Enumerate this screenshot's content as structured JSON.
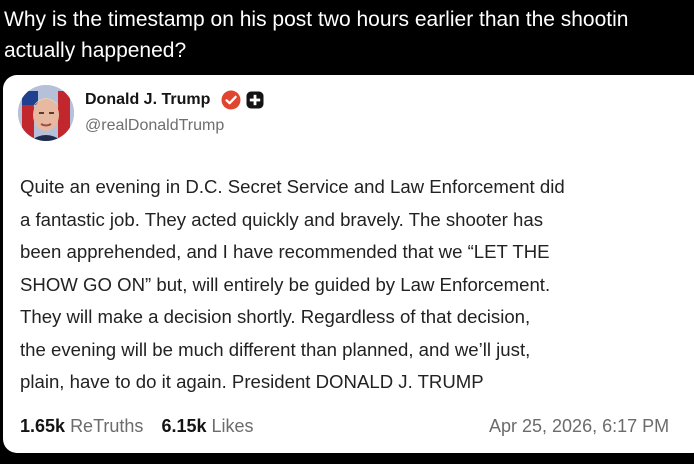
{
  "question": {
    "line1": "Why is the timestamp on his post two hours earlier than the shootin",
    "line2": "actually happened?"
  },
  "post": {
    "author_name": "Donald J. Trump",
    "handle": "@realDonaldTrump",
    "body_lines": [
      "Quite an evening in D.C. Secret Service and Law Enforcement did",
      "a fantastic job. They acted quickly and bravely. The shooter has",
      "been apprehended, and I have recommended that we “LET THE",
      "SHOW GO ON” but, will entirely be guided by Law Enforcement.",
      "They will make a decision shortly. Regardless of that decision,",
      "the evening will be much different than planned, and we’ll just,",
      "plain, have to do it again. President DONALD J. TRUMP"
    ],
    "retruths_count": "1.65k",
    "retruths_label": "ReTruths",
    "likes_count": "6.15k",
    "likes_label": "Likes",
    "timestamp": "Apr 25, 2026, 6:17 PM"
  },
  "icons": {
    "verified": "verified-badge-icon",
    "plus": "plus-badge-icon"
  },
  "colors": {
    "background": "#000000",
    "card": "#ffffff",
    "verified_badge": "#e0462f",
    "plus_badge": "#141414",
    "muted_text": "#6b6b6b"
  }
}
